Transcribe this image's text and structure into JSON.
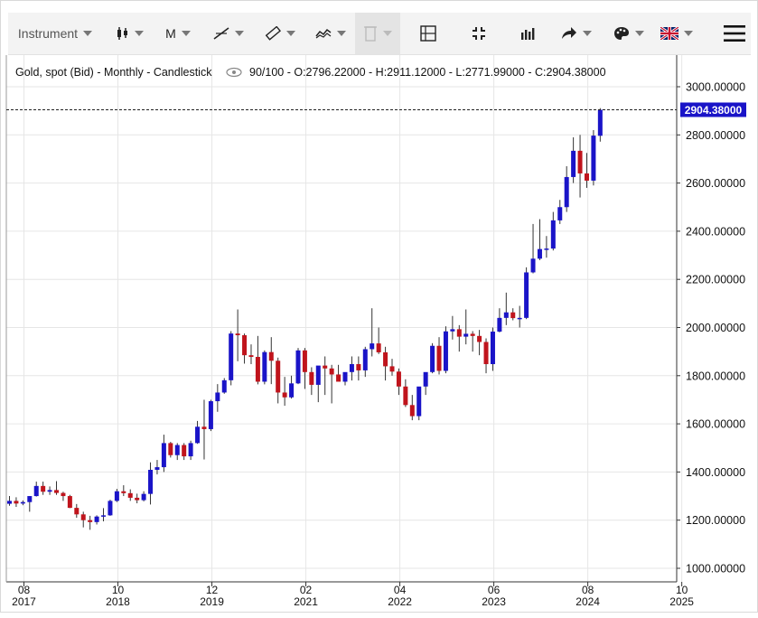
{
  "toolbar": {
    "instrument_label": "Instrument",
    "period_label": "M",
    "icons": [
      "candlestick-icon",
      "trendline-icon",
      "ruler-icon",
      "indicator-icon",
      "trash-icon",
      "layout-icon",
      "fullscreen-icon",
      "bars-icon",
      "share-icon",
      "palette-icon",
      "uk-flag-icon",
      "hamburger-icon"
    ]
  },
  "chart_data": {
    "type": "candlestick",
    "title": "Gold, spot (Bid) - Monthly - Candlestick",
    "quote": "90/100 - O:2796.22000 - H:2911.12000 - L:2771.99000 - C:2904.38000",
    "last_price_label": "2904.38000",
    "last_price": 2904.38,
    "ylim": [
      960,
      3100
    ],
    "y_ticks": [
      "1000.00000",
      "1200.00000",
      "1400.00000",
      "1600.00000",
      "1800.00000",
      "2000.00000",
      "2200.00000",
      "2400.00000",
      "2600.00000",
      "2800.00000",
      "3000.00000"
    ],
    "x_ticks": [
      {
        "month": "08",
        "year": "2017"
      },
      {
        "month": "10",
        "year": "2018"
      },
      {
        "month": "12",
        "year": "2019"
      },
      {
        "month": "02",
        "year": "2021"
      },
      {
        "month": "04",
        "year": "2022"
      },
      {
        "month": "06",
        "year": "2023"
      },
      {
        "month": "08",
        "year": "2024"
      },
      {
        "month": "10",
        "year": "2025"
      }
    ],
    "colors": {
      "up": "#1a14c8",
      "down": "#c0141c",
      "grid": "#e6e6e6",
      "axis": "#333333",
      "last_bg": "#1a14c8"
    },
    "candles": [
      [
        1268,
        1300,
        1260,
        1280
      ],
      [
        1280,
        1295,
        1255,
        1269
      ],
      [
        1269,
        1282,
        1262,
        1275
      ],
      [
        1275,
        1300,
        1235,
        1300
      ],
      [
        1300,
        1360,
        1298,
        1342
      ],
      [
        1342,
        1360,
        1305,
        1318
      ],
      [
        1318,
        1340,
        1305,
        1325
      ],
      [
        1325,
        1362,
        1305,
        1313
      ],
      [
        1313,
        1318,
        1280,
        1300
      ],
      [
        1300,
        1305,
        1250,
        1251
      ],
      [
        1251,
        1267,
        1210,
        1224
      ],
      [
        1224,
        1235,
        1170,
        1200
      ],
      [
        1200,
        1218,
        1160,
        1192
      ],
      [
        1192,
        1220,
        1182,
        1215
      ],
      [
        1215,
        1250,
        1195,
        1220
      ],
      [
        1220,
        1285,
        1218,
        1280
      ],
      [
        1280,
        1330,
        1275,
        1320
      ],
      [
        1320,
        1345,
        1300,
        1312
      ],
      [
        1312,
        1328,
        1280,
        1293
      ],
      [
        1293,
        1310,
        1270,
        1283
      ],
      [
        1283,
        1320,
        1278,
        1309
      ],
      [
        1309,
        1440,
        1265,
        1409
      ],
      [
        1409,
        1450,
        1390,
        1420
      ],
      [
        1420,
        1555,
        1400,
        1520
      ],
      [
        1520,
        1525,
        1460,
        1470
      ],
      [
        1470,
        1520,
        1450,
        1512
      ],
      [
        1512,
        1520,
        1450,
        1465
      ],
      [
        1465,
        1530,
        1450,
        1520
      ],
      [
        1520,
        1612,
        1517,
        1588
      ],
      [
        1588,
        1700,
        1452,
        1578
      ],
      [
        1578,
        1700,
        1570,
        1694
      ],
      [
        1694,
        1765,
        1650,
        1730
      ],
      [
        1730,
        1790,
        1725,
        1781
      ],
      [
        1781,
        1985,
        1760,
        1975
      ],
      [
        1975,
        2075,
        1860,
        1968
      ],
      [
        1968,
        1975,
        1850,
        1885
      ],
      [
        1885,
        1930,
        1848,
        1878
      ],
      [
        1878,
        1965,
        1764,
        1775
      ],
      [
        1775,
        1905,
        1764,
        1898
      ],
      [
        1898,
        1960,
        1765,
        1862
      ],
      [
        1862,
        1875,
        1685,
        1730
      ],
      [
        1730,
        1795,
        1675,
        1710
      ],
      [
        1710,
        1800,
        1705,
        1768
      ],
      [
        1768,
        1915,
        1765,
        1905
      ],
      [
        1905,
        1915,
        1745,
        1815
      ],
      [
        1815,
        1835,
        1720,
        1762
      ],
      [
        1762,
        1835,
        1690,
        1842
      ],
      [
        1842,
        1880,
        1720,
        1830
      ],
      [
        1830,
        1845,
        1685,
        1805
      ],
      [
        1805,
        1845,
        1780,
        1775
      ],
      [
        1775,
        1810,
        1760,
        1815
      ],
      [
        1815,
        1880,
        1780,
        1848
      ],
      [
        1848,
        1880,
        1780,
        1822
      ],
      [
        1822,
        1920,
        1795,
        1910
      ],
      [
        1910,
        2080,
        1880,
        1934
      ],
      [
        1934,
        2000,
        1890,
        1897
      ],
      [
        1897,
        1920,
        1780,
        1839
      ],
      [
        1839,
        1870,
        1800,
        1817
      ],
      [
        1817,
        1830,
        1720,
        1755
      ],
      [
        1755,
        1785,
        1670,
        1678
      ],
      [
        1678,
        1720,
        1615,
        1632
      ],
      [
        1632,
        1675,
        1615,
        1755
      ],
      [
        1755,
        1785,
        1720,
        1815
      ],
      [
        1815,
        1935,
        1810,
        1924
      ],
      [
        1924,
        1960,
        1805,
        1820
      ],
      [
        1820,
        2005,
        1810,
        1984
      ],
      [
        1984,
        2048,
        1950,
        1993
      ],
      [
        1993,
        2010,
        1900,
        1962
      ],
      [
        1962,
        2075,
        1930,
        1974
      ],
      [
        1974,
        1985,
        1900,
        1965
      ],
      [
        1965,
        1990,
        1885,
        1940
      ],
      [
        1940,
        1955,
        1810,
        1848
      ],
      [
        1848,
        2000,
        1820,
        1983
      ],
      [
        1983,
        2080,
        1980,
        2040
      ],
      [
        2040,
        2145,
        2010,
        2063
      ],
      [
        2063,
        2080,
        2030,
        2039
      ],
      [
        2039,
        2090,
        2000,
        2040
      ],
      [
        2040,
        2250,
        2035,
        2229
      ],
      [
        2229,
        2430,
        2225,
        2286
      ],
      [
        2286,
        2450,
        2280,
        2326
      ],
      [
        2326,
        2380,
        2290,
        2328
      ],
      [
        2328,
        2480,
        2320,
        2445
      ],
      [
        2445,
        2530,
        2430,
        2500
      ],
      [
        2500,
        2670,
        2480,
        2625
      ],
      [
        2625,
        2790,
        2600,
        2734
      ],
      [
        2734,
        2800,
        2540,
        2640
      ],
      [
        2640,
        2725,
        2580,
        2610
      ],
      [
        2610,
        2820,
        2590,
        2797
      ],
      [
        2796.22,
        2911.12,
        2771.99,
        2904.38
      ]
    ]
  }
}
